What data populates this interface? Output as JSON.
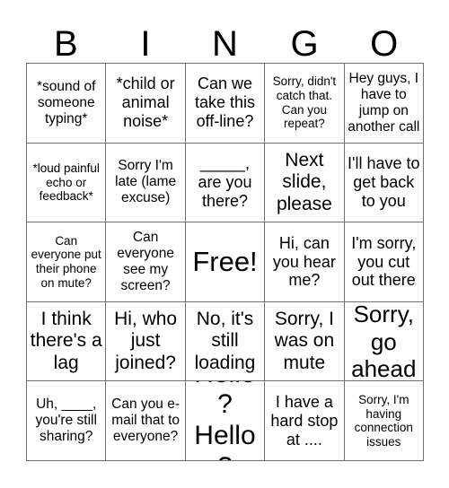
{
  "card": {
    "title": "BINGO",
    "header_letters": [
      "B",
      "I",
      "N",
      "G",
      "O"
    ],
    "columns": [
      {
        "letter": "B",
        "cells": [
          {
            "text": "*sound of someone typing*",
            "size": "s"
          },
          {
            "text": "*loud painful echo or feedback*",
            "size": "xs"
          },
          {
            "text": "Can everyone put their phone on mute?",
            "size": "xs"
          },
          {
            "text": "I think there's a lag",
            "size": "l"
          },
          {
            "text": "Uh, ____, you're still sharing?",
            "size": "s"
          }
        ]
      },
      {
        "letter": "I",
        "cells": [
          {
            "text": "*child or animal noise*",
            "size": "m"
          },
          {
            "text": "Sorry I'm late (lame excuse)",
            "size": "s"
          },
          {
            "text": "Can everyone see my screen?",
            "size": "s"
          },
          {
            "text": "Hi, who just joined?",
            "size": "l"
          },
          {
            "text": "Can you e-mail that to everyone?",
            "size": "s"
          }
        ]
      },
      {
        "letter": "N",
        "cells": [
          {
            "text": "Can we take this off-line?",
            "size": "m"
          },
          {
            "text": "_____, are you there?",
            "size": "m"
          },
          {
            "text": "Free!",
            "size": "free"
          },
          {
            "text": "No, it's still loading",
            "size": "l"
          },
          {
            "text": "Hello? Hello?",
            "size": "xxl"
          }
        ]
      },
      {
        "letter": "G",
        "cells": [
          {
            "text": "Sorry, didn't catch that. Can you repeat?",
            "size": "xs"
          },
          {
            "text": "Next slide, please",
            "size": "l"
          },
          {
            "text": "Hi, can you hear me?",
            "size": "m"
          },
          {
            "text": "Sorry, I was on mute",
            "size": "l"
          },
          {
            "text": "I have a hard stop at ....",
            "size": "m"
          }
        ]
      },
      {
        "letter": "O",
        "cells": [
          {
            "text": "Hey guys, I have to jump on another call",
            "size": "s"
          },
          {
            "text": "I'll have to get back to you",
            "size": "m"
          },
          {
            "text": "I'm sorry, you cut out there",
            "size": "m"
          },
          {
            "text": "Sorry, go ahead",
            "size": "xl"
          },
          {
            "text": "Sorry, I'm having connection issues",
            "size": "xs"
          }
        ]
      }
    ],
    "rows": [
      [
        "*sound of someone typing*",
        "*child or animal noise*",
        "Can we take this off-line?",
        "Sorry, didn't catch that. Can you repeat?",
        "Hey guys, I have to jump on another call"
      ],
      [
        "*loud painful echo or feedback*",
        "Sorry I'm late (lame excuse)",
        "_____, are you there?",
        "Next slide, please",
        "I'll have to get back to you"
      ],
      [
        "Can everyone put their phone on mute?",
        "Can everyone see my screen?",
        "Free!",
        "Hi, can you hear me?",
        "I'm sorry, you cut out there"
      ],
      [
        "I think there's a lag",
        "Hi, who just joined?",
        "No, it's still loading",
        "Sorry, I was on mute",
        "Sorry, go ahead"
      ],
      [
        "Uh, ____, you're still sharing?",
        "Can you e-mail that to everyone?",
        "Hello? Hello?",
        "I have a hard stop at ....",
        "Sorry, I'm having connection issues"
      ]
    ],
    "free_space": {
      "row": 3,
      "column": 3,
      "label": "Free!"
    },
    "colors": {
      "background": "#ffffff",
      "text": "#000000",
      "grid_line": "#6f6f6f"
    }
  }
}
